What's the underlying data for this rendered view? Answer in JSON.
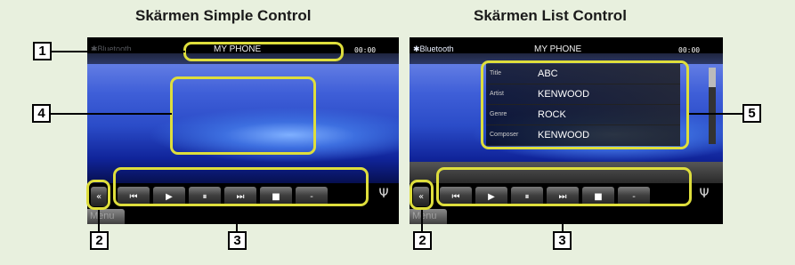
{
  "headings": {
    "simple": "Skärmen Simple Control",
    "list": "Skärmen List Control"
  },
  "screen": {
    "source_label": "Bluetooth",
    "phone_name": "MY PHONE",
    "time": "00:00",
    "menu_label": "Menu",
    "controls": {
      "back": "«",
      "prev": "⏮",
      "play": "▶",
      "pause": "⏸",
      "next": "⏭",
      "stop": "■",
      "more": "-"
    }
  },
  "list_rows": [
    {
      "label": "Title",
      "value": "ABC"
    },
    {
      "label": "Artist",
      "value": "KENWOOD"
    },
    {
      "label": "Genre",
      "value": "ROCK"
    },
    {
      "label": "Composer",
      "value": "KENWOOD"
    }
  ],
  "callouts": {
    "n1": "1",
    "n2": "2",
    "n3": "3",
    "n4": "4",
    "n5": "5"
  },
  "icons": [
    "bluetooth-icon",
    "antenna-icon",
    "back-icon",
    "prev-icon",
    "play-icon",
    "pause-icon",
    "next-icon",
    "stop-icon"
  ],
  "colors": {
    "highlight": "#dede3c",
    "page_bg": "#e8f0de"
  }
}
